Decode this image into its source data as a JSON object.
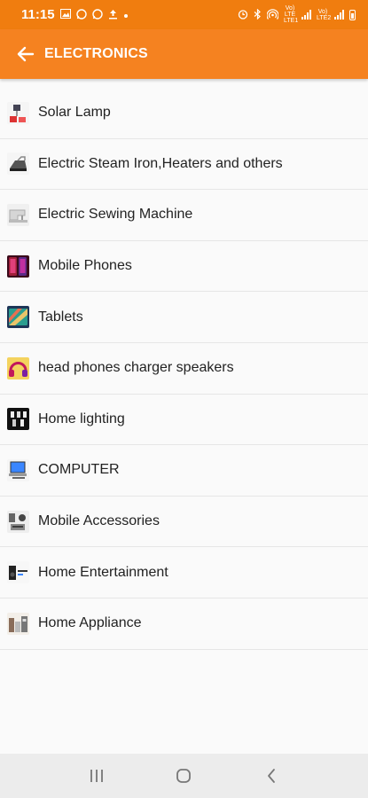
{
  "status_bar": {
    "time": "11:15",
    "left_icons": [
      "gallery-icon",
      "whatsapp-icon",
      "whatsapp-icon",
      "upload-icon",
      "dot-icon"
    ],
    "right_icons": [
      "alarm-icon",
      "bluetooth-icon",
      "hotspot-icon",
      "volte-icon",
      "signal-icon",
      "volte-icon",
      "signal-icon",
      "battery-icon"
    ],
    "network_label_1": "Vo) LTE LTE1",
    "network_label_2": "Vo) LTE2"
  },
  "app_bar": {
    "title": "ELECTRONICS",
    "back_icon": "arrow-left-icon",
    "background": "#f58220"
  },
  "categories": [
    {
      "label": "Solar Lamp",
      "icon": "solar-lamp-thumbnail",
      "color": "#d33"
    },
    {
      "label": "Electric Steam Iron,Heaters and others",
      "icon": "steam-iron-thumbnail",
      "color": "#555"
    },
    {
      "label": "Electric Sewing Machine",
      "icon": "sewing-machine-thumbnail",
      "color": "#bbb"
    },
    {
      "label": "Mobile Phones",
      "icon": "mobile-phones-thumbnail",
      "color": "#a0203a"
    },
    {
      "label": "Tablets",
      "icon": "tablets-thumbnail",
      "color": "#2a9d8f"
    },
    {
      "label": "head phones charger speakers",
      "icon": "headphones-thumbnail",
      "color": "#e9c46a"
    },
    {
      "label": "Home lighting",
      "icon": "home-lighting-thumbnail",
      "color": "#222"
    },
    {
      "label": "COMPUTER",
      "icon": "computer-thumbnail",
      "color": "#3a86ff"
    },
    {
      "label": "Mobile Accessories",
      "icon": "mobile-accessories-thumbnail",
      "color": "#666"
    },
    {
      "label": "Home Entertainment",
      "icon": "home-entertainment-thumbnail",
      "color": "#333"
    },
    {
      "label": "Home Appliance",
      "icon": "home-appliance-thumbnail",
      "color": "#8a6d5a"
    }
  ],
  "nav_bar": {
    "buttons": [
      "recent-apps-icon",
      "home-icon",
      "back-icon"
    ]
  }
}
